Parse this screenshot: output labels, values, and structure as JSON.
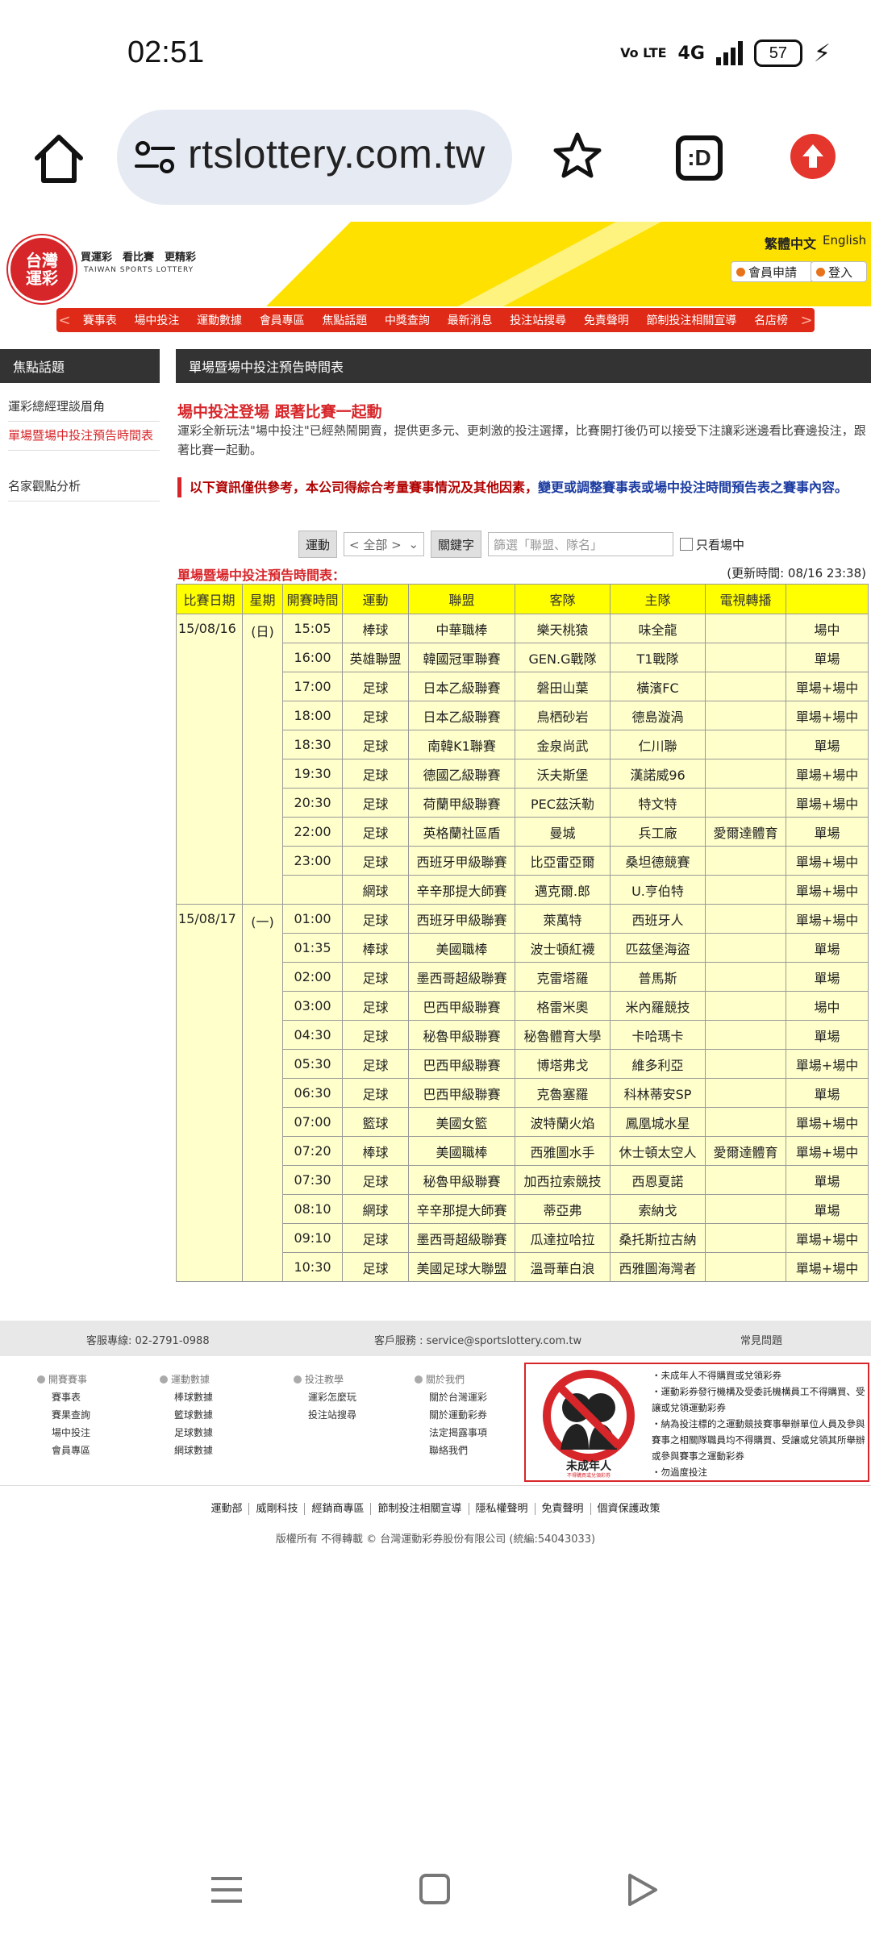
{
  "status_bar": {
    "time": "02:51",
    "network": "4G",
    "volte": "Vo LTE",
    "battery": "57"
  },
  "browser": {
    "url": "rtslottery.com.tw",
    "url_full": "sportslottery.com.tw",
    "tabs_label": ":D"
  },
  "site": {
    "logo_line1": "台灣",
    "logo_line2": "運彩",
    "slogan": "買運彩　看比賽　更精彩",
    "slogan_en": "TAIWAN SPORTS LOTTERY",
    "lang_tc": "繁體中文",
    "lang_en": "English",
    "member_btn": "會員申請",
    "login_btn": "登入",
    "nav_left": "<",
    "nav_right": ">",
    "nav": [
      "賽事表",
      "場中投注",
      "運動數據",
      "會員專區",
      "焦點話題",
      "中獎查詢",
      "最新消息",
      "投注站搜尋",
      "免責聲明",
      "節制投注相關宣導",
      "名店榜"
    ]
  },
  "sidebar": {
    "title": "焦點話題",
    "items": [
      "運彩總經理談眉角",
      "單場暨場中投注預告時間表",
      "名家觀點分析"
    ]
  },
  "main": {
    "title": "單場暨場中投注預告時間表",
    "promo_title": "場中投注登場 跟著比賽一起動",
    "promo_desc": "運彩全新玩法\"場中投注\"已經熱鬧開賣，提供更多元、更刺激的投注選擇，比賽開打後仍可以接受下注讓彩迷邊看比賽邊投注，跟著比賽一起動。",
    "notice_red": "以下資訊僅供參考，本公司得綜合考量賽事情況及其他因素，",
    "notice_blue": "變更或調整賽事表或場中投注時間預告表之賽事內容。",
    "filter": {
      "sport_label": "運動",
      "sport_value": "< 全部 >",
      "keyword_label": "關鍵字",
      "keyword_placeholder": "篩選「聯盟、隊名」",
      "live_only": "只看場中"
    },
    "table_title": "單場暨場中投注預告時間表：",
    "updated": "(更新時間: 08/16 23:38)"
  },
  "table": {
    "headers": [
      "比賽日期",
      "星期",
      "開賽時間",
      "運動",
      "聯盟",
      "客隊",
      "主隊",
      "電視轉播",
      ""
    ],
    "groups": [
      {
        "date": "15/08/16",
        "weekday": "(日)",
        "rows": [
          [
            "15:05",
            "棒球",
            "中華職棒",
            "樂天桃猿",
            "味全龍",
            "",
            "場中"
          ],
          [
            "16:00",
            "英雄聯盟",
            "韓國冠軍聯賽",
            "GEN.G戰隊",
            "T1戰隊",
            "",
            "單場"
          ],
          [
            "17:00",
            "足球",
            "日本乙級聯賽",
            "磐田山葉",
            "橫濱FC",
            "",
            "單場+場中"
          ],
          [
            "18:00",
            "足球",
            "日本乙級聯賽",
            "鳥栖砂岩",
            "德島漩渦",
            "",
            "單場+場中"
          ],
          [
            "18:30",
            "足球",
            "南韓K1聯賽",
            "金泉尚武",
            "仁川聯",
            "",
            "單場"
          ],
          [
            "19:30",
            "足球",
            "德國乙級聯賽",
            "沃夫斯堡",
            "漢諾威96",
            "",
            "單場+場中"
          ],
          [
            "20:30",
            "足球",
            "荷蘭甲級聯賽",
            "PEC茲沃勒",
            "特文特",
            "",
            "單場+場中"
          ],
          [
            "22:00",
            "足球",
            "英格蘭社區盾",
            "曼城",
            "兵工廠",
            "愛爾達體育",
            "單場"
          ],
          [
            "23:00",
            "足球",
            "西班牙甲級聯賽",
            "比亞雷亞爾",
            "桑坦德競賽",
            "",
            "單場+場中"
          ],
          [
            "",
            "網球",
            "辛辛那提大師賽",
            "邁克爾.郎",
            "U.亨伯特",
            "",
            "單場+場中"
          ]
        ]
      },
      {
        "date": "15/08/17",
        "weekday": "(一)",
        "rows": [
          [
            "01:00",
            "足球",
            "西班牙甲級聯賽",
            "萊萬特",
            "西班牙人",
            "",
            "單場+場中"
          ],
          [
            "01:35",
            "棒球",
            "美國職棒",
            "波士頓紅襪",
            "匹茲堡海盜",
            "",
            "單場"
          ],
          [
            "02:00",
            "足球",
            "墨西哥超級聯賽",
            "克雷塔羅",
            "普馬斯",
            "",
            "單場"
          ],
          [
            "03:00",
            "足球",
            "巴西甲級聯賽",
            "格雷米奧",
            "米內羅競技",
            "",
            "場中"
          ],
          [
            "04:30",
            "足球",
            "秘魯甲級聯賽",
            "秘魯體育大學",
            "卡哈瑪卡",
            "",
            "單場"
          ],
          [
            "05:30",
            "足球",
            "巴西甲級聯賽",
            "博塔弗戈",
            "維多利亞",
            "",
            "單場+場中"
          ],
          [
            "06:30",
            "足球",
            "巴西甲級聯賽",
            "克魯塞羅",
            "科林蒂安SP",
            "",
            "單場"
          ],
          [
            "07:00",
            "籃球",
            "美國女籃",
            "波特蘭火焰",
            "鳳凰城水星",
            "",
            "單場+場中"
          ],
          [
            "07:20",
            "棒球",
            "美國職棒",
            "西雅圖水手",
            "休士頓太空人",
            "愛爾達體育",
            "單場+場中"
          ],
          [
            "07:30",
            "足球",
            "秘魯甲級聯賽",
            "加西拉索競技",
            "西恩夏諾",
            "",
            "單場"
          ],
          [
            "08:10",
            "網球",
            "辛辛那提大師賽",
            "蒂亞弗",
            "索納戈",
            "",
            "單場"
          ],
          [
            "09:10",
            "足球",
            "墨西哥超級聯賽",
            "瓜達拉哈拉",
            "桑托斯拉古納",
            "",
            "單場+場中"
          ],
          [
            "10:30",
            "足球",
            "美國足球大聯盟",
            "溫哥華白浪",
            "西雅圖海灣者",
            "",
            "單場+場中"
          ]
        ]
      }
    ]
  },
  "footer": {
    "hotline": "客服專線: 02-2791-0988",
    "email": "客戶服務 : service@sportslottery.com.tw",
    "faq": "常見問題",
    "cols": [
      {
        "title": "開賽賽事",
        "links": [
          "賽事表",
          "賽果查詢",
          "場中投注",
          "會員專區"
        ]
      },
      {
        "title": "運動數據",
        "links": [
          "棒球數據",
          "籃球數據",
          "足球數據",
          "網球數據"
        ]
      },
      {
        "title": "投注教學",
        "links": [
          "運彩怎麼玩",
          "投注站搜尋"
        ]
      },
      {
        "title": "關於我們",
        "links": [
          "關於台灣運彩",
          "關於運動彩券",
          "法定揭露事項",
          "聯絡我們"
        ]
      }
    ],
    "minor_caption": "未成年人",
    "minor_caption_small": "不得購買或兌領彩券",
    "minor_rules": [
      "・未成年人不得購買或兌領彩券",
      "・運動彩券發行機構及受委託機構員工不得購買、受讓或兌領運動彩券",
      "・納為投注標的之運動競技賽事舉辦單位人員及參與賽事之相關隊職員均不得購買、受讓或兌領其所舉辦或參與賽事之運動彩券",
      "・勿過度投注"
    ],
    "links": [
      "運動部",
      "威剛科技",
      "經銷商專區",
      "節制投注相關宣導",
      "隱私權聲明",
      "免責聲明",
      "個資保護政策"
    ],
    "copyright": "版權所有 不得轉載 © 台灣運動彩券股份有限公司 (統編:54043033)"
  },
  "colors": {
    "brand_red": "#d7262a",
    "nav_red": "#df2a17",
    "banner_yellow": "#ffe100",
    "table_header": "#ffff00",
    "table_cell": "#ffffcc",
    "notice_blue": "#1a3aa0"
  }
}
